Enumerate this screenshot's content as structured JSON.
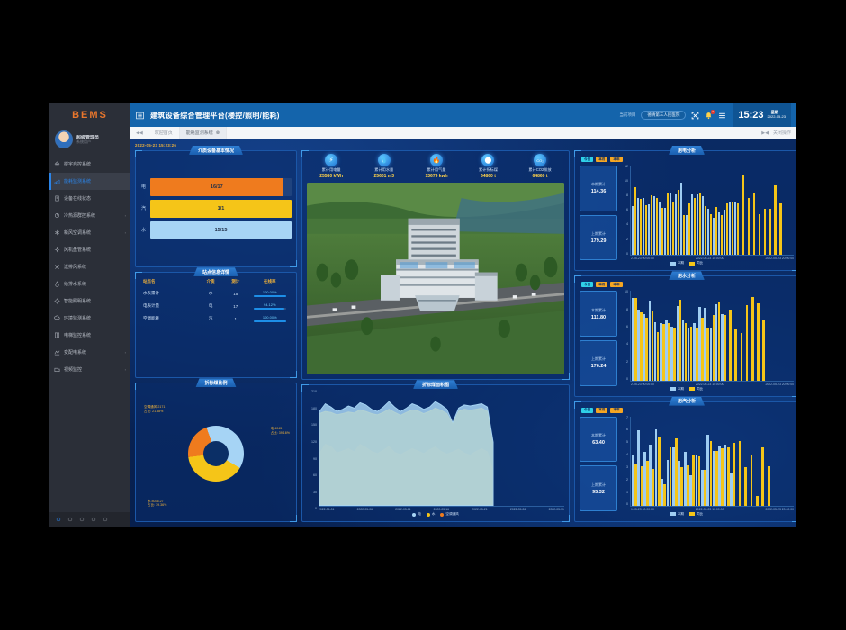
{
  "sidebar": {
    "logo": "BEMS",
    "user": {
      "name": "超级管理员",
      "role": "系统用户"
    },
    "items": [
      {
        "label": "楼宇自控系统",
        "icon": "building-icon",
        "arrow": "",
        "active": false
      },
      {
        "label": "能耗监测系统",
        "icon": "energy-icon",
        "arrow": "",
        "active": true
      },
      {
        "label": "设备在线状态",
        "icon": "device-status-icon",
        "arrow": "",
        "active": false
      },
      {
        "label": "冷热源群控系统",
        "icon": "cooling-icon",
        "arrow": "›",
        "active": false
      },
      {
        "label": "新风空调系统",
        "icon": "hvac-icon",
        "arrow": "›",
        "active": false
      },
      {
        "label": "风机盘管系统",
        "icon": "fancoil-icon",
        "arrow": "",
        "active": false
      },
      {
        "label": "送排风系统",
        "icon": "ventilation-icon",
        "arrow": "",
        "active": false
      },
      {
        "label": "给排水系统",
        "icon": "water-icon",
        "arrow": "",
        "active": false
      },
      {
        "label": "智能照明系统",
        "icon": "lighting-icon",
        "arrow": "",
        "active": false
      },
      {
        "label": "环境监测系统",
        "icon": "environment-icon",
        "arrow": "",
        "active": false
      },
      {
        "label": "电梯监控系统",
        "icon": "elevator-icon",
        "arrow": "",
        "active": false
      },
      {
        "label": "变配电系统",
        "icon": "power-icon",
        "arrow": "›",
        "active": false
      },
      {
        "label": "视频监控",
        "icon": "camera-icon",
        "arrow": "›",
        "active": false
      }
    ],
    "taskbar_icons": [
      "eye-icon",
      "bell-icon",
      "chart-icon",
      "gear-icon",
      "wrench-icon"
    ]
  },
  "header": {
    "menu_icon": "burger-icon",
    "title": "建筑设备综合管理平台(楼控/照明/能耗)",
    "project_label": "当前项目",
    "project_name": "德清第三人民医院",
    "fullscreen_icon": "fullscreen-icon",
    "bell_icon": "bell-icon",
    "bell_badge": "3",
    "list_icon": "list-icon",
    "time": "15:23",
    "weekday": "星期一",
    "date": "2022-05-23"
  },
  "tabs": {
    "nav_icon": "collapse-left-icon",
    "items": [
      {
        "label": "欢迎首页",
        "closable": false,
        "active": false
      },
      {
        "label": "能耗监测系统",
        "closable": true,
        "active": true
      }
    ],
    "right_icon": "collapse-right-icon",
    "right_label": "关闭操作"
  },
  "dashboard": {
    "timestamp": "2022-05-23 15:23:26",
    "media_card": {
      "title": "介质设备基本情况",
      "rows": [
        {
          "label": "电",
          "value": "16/17",
          "percent": 94,
          "color": "#ef7b1e"
        },
        {
          "label": "汽",
          "value": "1/1",
          "percent": 100,
          "color": "#f5c518"
        },
        {
          "label": "水",
          "value": "15/15",
          "percent": 100,
          "color": "#a6d4f5"
        }
      ]
    },
    "site_card": {
      "title": "站点信息详情",
      "columns": [
        "站点名",
        "介质",
        "测计",
        "在线率"
      ],
      "rows": [
        {
          "name": "水表累计",
          "media": "水",
          "count": "15",
          "rate": "100.00%",
          "rate_pct": 100
        },
        {
          "name": "电表计量",
          "media": "电",
          "count": "17",
          "rate": "94.12%",
          "rate_pct": 94
        },
        {
          "name": "空调能耗",
          "media": "汽",
          "count": "1",
          "rate": "100.00%",
          "rate_pct": 100
        }
      ]
    },
    "kpis": [
      {
        "icon": "bolt-icon",
        "glyph": "⚡",
        "label": "累计用电量",
        "value": "25580 kWh"
      },
      {
        "icon": "water-drop-icon",
        "glyph": "💧",
        "label": "累计用水量",
        "value": "25601 m3"
      },
      {
        "icon": "flame-icon",
        "glyph": "🔥",
        "label": "累计用气量",
        "value": "13679 kwh"
      },
      {
        "icon": "coal-icon",
        "glyph": "⬤",
        "label": "累计折标煤",
        "value": "64860 t"
      },
      {
        "icon": "co2-icon",
        "glyph": "CO₂",
        "label": "累计CO2排放",
        "value": "64860 t"
      }
    ],
    "hero": {
      "name": "building-aerial-photo",
      "alt": "园区建筑航拍图"
    },
    "donut_card": {
      "title": "折标煤比例",
      "slices": [
        {
          "name": "电",
          "value": "4045",
          "pct": "39.16%",
          "label": "电:4045\n占比: 39.16%",
          "color": "#a6d4f5",
          "share": 39.16
        },
        {
          "name": "水",
          "value": "4036.27",
          "pct": "39.36%",
          "label": "水:4036.27\n占比: 39.36%",
          "color": "#f5c518",
          "share": 39.36
        },
        {
          "name": "空调通风",
          "value": "2171",
          "pct": "21.58%",
          "label": "空调通风:2171\n占比: 21.58%",
          "color": "#ef7b1e",
          "share": 21.58
        }
      ]
    }
  },
  "chart_data": [
    {
      "type": "area",
      "title": "折标煤面积图",
      "xlabel": "",
      "ylabel": "",
      "ylim": [
        0,
        210
      ],
      "yticks": [
        0,
        30,
        60,
        90,
        120,
        150,
        180,
        210
      ],
      "xticks": [
        "2022-05-01",
        "2022-05-06",
        "2022-05-11",
        "2022-05-16",
        "2022-05-21",
        "2022-05-26",
        "2022-05-31"
      ],
      "legend": [
        "电",
        "水",
        "空调通风"
      ],
      "legend_colors": [
        "#a6d4f5",
        "#f5c518",
        "#ef7b1e"
      ],
      "legend_position": "bottom",
      "grid": false,
      "series": [
        {
          "name": "空调通风",
          "color": "#ef7b1e",
          "values": [
            95,
            112,
            108,
            96,
            100,
            104,
            98,
            112,
            106,
            99,
            95,
            101,
            108,
            97,
            93,
            99,
            104,
            100,
            95,
            102,
            107,
            99,
            94,
            98,
            103,
            96,
            92,
            99,
            104,
            98,
            62
          ]
        },
        {
          "name": "水",
          "color": "#f5c518",
          "values": [
            168,
            172,
            170,
            166,
            168,
            171,
            169,
            175,
            172,
            168,
            166,
            170,
            176,
            170,
            165,
            170,
            175,
            173,
            168,
            172,
            178,
            174,
            168,
            150,
            172,
            176,
            174,
            176,
            178,
            172,
            112
          ]
        },
        {
          "name": "电",
          "color": "#a6d4f5",
          "values": [
            172,
            186,
            180,
            172,
            176,
            182,
            178,
            188,
            184,
            176,
            172,
            180,
            190,
            180,
            172,
            178,
            186,
            182,
            176,
            180,
            190,
            184,
            176,
            152,
            178,
            184,
            182,
            184,
            186,
            180,
            116
          ]
        }
      ]
    },
    {
      "type": "bar",
      "title": "用电分析",
      "legend_top": [
        "今日",
        "本月",
        "本年"
      ],
      "legend_top_colors": [
        "#2fd0e8",
        "#f5a623",
        "#f5a623"
      ],
      "stats": [
        {
          "label": "本期累计",
          "value": "114.36"
        },
        {
          "label": "上期累计",
          "value": "179.29"
        }
      ],
      "ylim": [
        0,
        12
      ],
      "yticks": [
        0,
        2,
        4,
        6,
        8,
        10,
        12
      ],
      "xticks": [
        "2-05-23 00:00:00",
        "2022-05-23 10:00:00",
        "2022-05-23 20:00:00"
      ],
      "legend": [
        "本期",
        "同比"
      ],
      "legend_colors": [
        "#9fcdf2",
        "#f5c518"
      ],
      "legend_position": "bottom",
      "series": [
        {
          "name": "本期",
          "color": "#9fcdf2",
          "values": [
            6.6,
            7.6,
            7.7,
            6.8,
            7.9,
            7.0,
            6.3,
            8.2,
            8.1,
            9.7,
            5.3,
            8.1,
            8.1,
            7.9,
            6.2,
            5.0,
            5.7,
            6.1,
            7.0,
            7.1,
            0,
            0,
            0,
            0,
            0,
            0,
            0,
            0,
            0,
            0
          ]
        },
        {
          "name": "同比",
          "color": "#f5c518",
          "values": [
            9.1,
            7.5,
            6.7,
            8.0,
            7.7,
            6.3,
            8.3,
            7.1,
            8.8,
            5.3,
            6.9,
            7.7,
            8.2,
            6.6,
            5.5,
            6.5,
            5.4,
            6.9,
            7.1,
            6.9,
            10.7,
            7.7,
            8.4,
            5.5,
            6.2,
            6.2,
            9.4,
            6.9,
            0,
            0
          ]
        }
      ]
    },
    {
      "type": "bar",
      "title": "用水分析",
      "legend_top": [
        "今日",
        "本月",
        "本年"
      ],
      "legend_top_colors": [
        "#2fd0e8",
        "#f5a623",
        "#f5a623"
      ],
      "stats": [
        {
          "label": "本期累计",
          "value": "111.80"
        },
        {
          "label": "上期累计",
          "value": "176.24"
        }
      ],
      "ylim": [
        0,
        10
      ],
      "yticks": [
        0,
        2,
        4,
        6,
        8,
        10
      ],
      "xticks": [
        "2-05-23 00:00:00",
        "2022-05-23 10:00:00",
        "2022-05-23 20:00:00"
      ],
      "legend": [
        "本期",
        "同比"
      ],
      "legend_colors": [
        "#9fcdf2",
        "#f5c518"
      ],
      "legend_position": "bottom",
      "series": [
        {
          "name": "本期",
          "color": "#9fcdf2",
          "values": [
            9.2,
            7.9,
            7.4,
            8.9,
            6.5,
            6.4,
            6.7,
            6.0,
            8.3,
            6.7,
            5.9,
            6.4,
            8.2,
            8.1,
            5.9,
            8.5,
            7.4,
            0,
            0,
            0,
            0,
            0,
            0,
            0,
            0,
            0,
            0,
            0,
            0
          ]
        },
        {
          "name": "同比",
          "color": "#f5c518",
          "values": [
            9.2,
            7.6,
            7.0,
            7.7,
            5.4,
            6.3,
            6.4,
            5.9,
            9.0,
            6.4,
            6.0,
            5.9,
            7.0,
            5.9,
            7.3,
            8.7,
            7.3,
            7.9,
            5.7,
            5.3,
            8.4,
            9.3,
            8.6,
            6.7,
            0,
            0,
            0,
            0,
            0
          ]
        }
      ]
    },
    {
      "type": "bar",
      "title": "用汽分析",
      "legend_top": [
        "今日",
        "本月",
        "本年"
      ],
      "legend_top_colors": [
        "#2fd0e8",
        "#f5a623",
        "#f5a623"
      ],
      "stats": [
        {
          "label": "本期累计",
          "value": "63.40"
        },
        {
          "label": "上期累计",
          "value": "95.32"
        }
      ],
      "ylim": [
        0,
        7
      ],
      "yticks": [
        0,
        1,
        2,
        3,
        4,
        5,
        6,
        7
      ],
      "xticks": [
        "1-05-23 00:00:00",
        "2022-05-23 10:00:00",
        "2022-05-23 20:00:00"
      ],
      "legend": [
        "本期",
        "同比"
      ],
      "legend_colors": [
        "#9fcdf2",
        "#f5c518"
      ],
      "legend_position": "bottom",
      "series": [
        {
          "name": "本期",
          "color": "#9fcdf2",
          "values": [
            4.0,
            5.9,
            4.2,
            4.8,
            6.0,
            2.1,
            3.6,
            4.6,
            3.5,
            4.2,
            2.4,
            4.0,
            2.8,
            5.6,
            4.3,
            4.7,
            4.8,
            2.6,
            0,
            0,
            0,
            0,
            0,
            0,
            0,
            0,
            0,
            0
          ]
        },
        {
          "name": "同比",
          "color": "#f5c518",
          "values": [
            3.3,
            3.1,
            3.5,
            2.9,
            5.4,
            1.7,
            4.6,
            5.3,
            3.0,
            3.2,
            4.0,
            3.9,
            2.8,
            5.1,
            4.3,
            4.5,
            4.6,
            4.9,
            5.1,
            3.0,
            4.0,
            0.8,
            4.6,
            3.1,
            0,
            0,
            0,
            0
          ]
        }
      ]
    }
  ]
}
